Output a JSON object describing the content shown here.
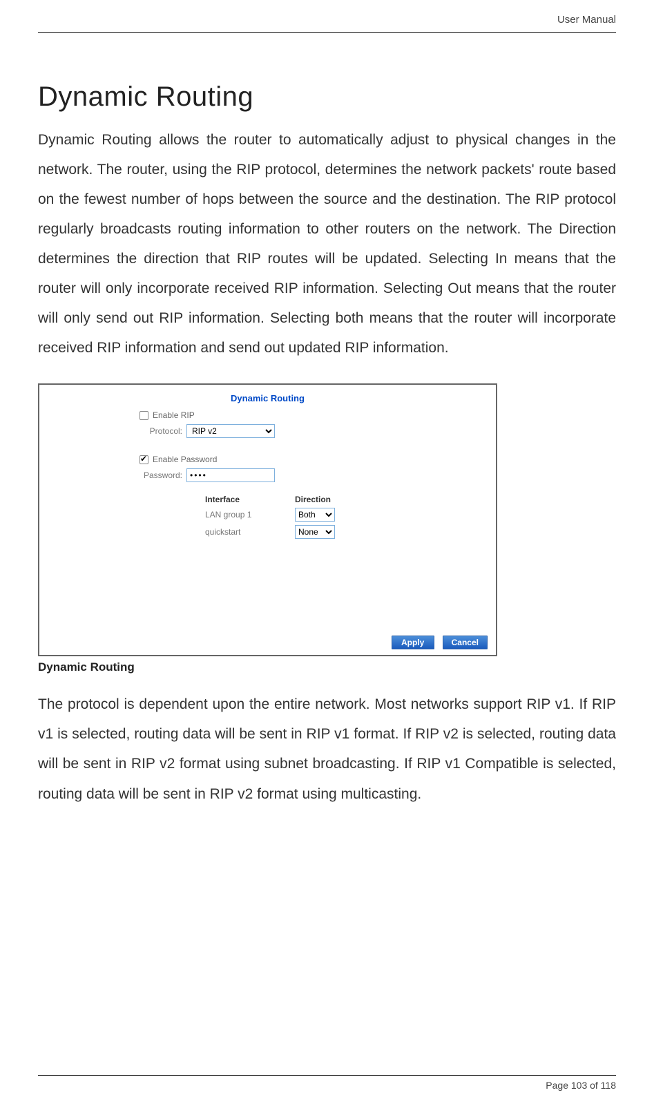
{
  "header": {
    "label": "User Manual"
  },
  "title": "Dynamic Routing",
  "para1": "Dynamic Routing allows the router to automatically adjust to physical changes in the network. The router, using the RIP protocol, determines the network packets' route based on the fewest number of hops between the source and the destination. The RIP protocol regularly broadcasts routing information to other routers on the network. The Direction determines the direction that RIP routes will be updated. Selecting In means that the router will only incorporate received RIP information. Selecting Out means that the router will only send out RIP information. Selecting both means that the router will incorporate received RIP information and send out updated RIP information.",
  "panel": {
    "title": "Dynamic Routing",
    "enable_rip_label": "Enable RIP",
    "enable_rip_checked": false,
    "protocol_label": "Protocol:",
    "protocol_value": "RIP v2",
    "enable_pw_label": "Enable Password",
    "enable_pw_checked": true,
    "password_label": "Password:",
    "password_value": "••••",
    "table": {
      "headers": [
        "Interface",
        "Direction"
      ],
      "rows": [
        {
          "iface": "LAN group 1",
          "dir": "Both"
        },
        {
          "iface": "quickstart",
          "dir": "None"
        }
      ]
    },
    "buttons": {
      "apply": "Apply",
      "cancel": "Cancel"
    }
  },
  "caption": "Dynamic Routing",
  "para2": "The protocol is dependent upon the entire network. Most networks support RIP v1. If RIP v1 is selected, routing data will be sent in RIP v1 format.  If RIP v2 is selected, routing data will be sent in RIP v2 format using subnet broadcasting.  If RIP v1 Compatible is selected, routing data will be sent in RIP v2 format using multicasting.",
  "footer": {
    "text": "Page 103 of 118"
  }
}
